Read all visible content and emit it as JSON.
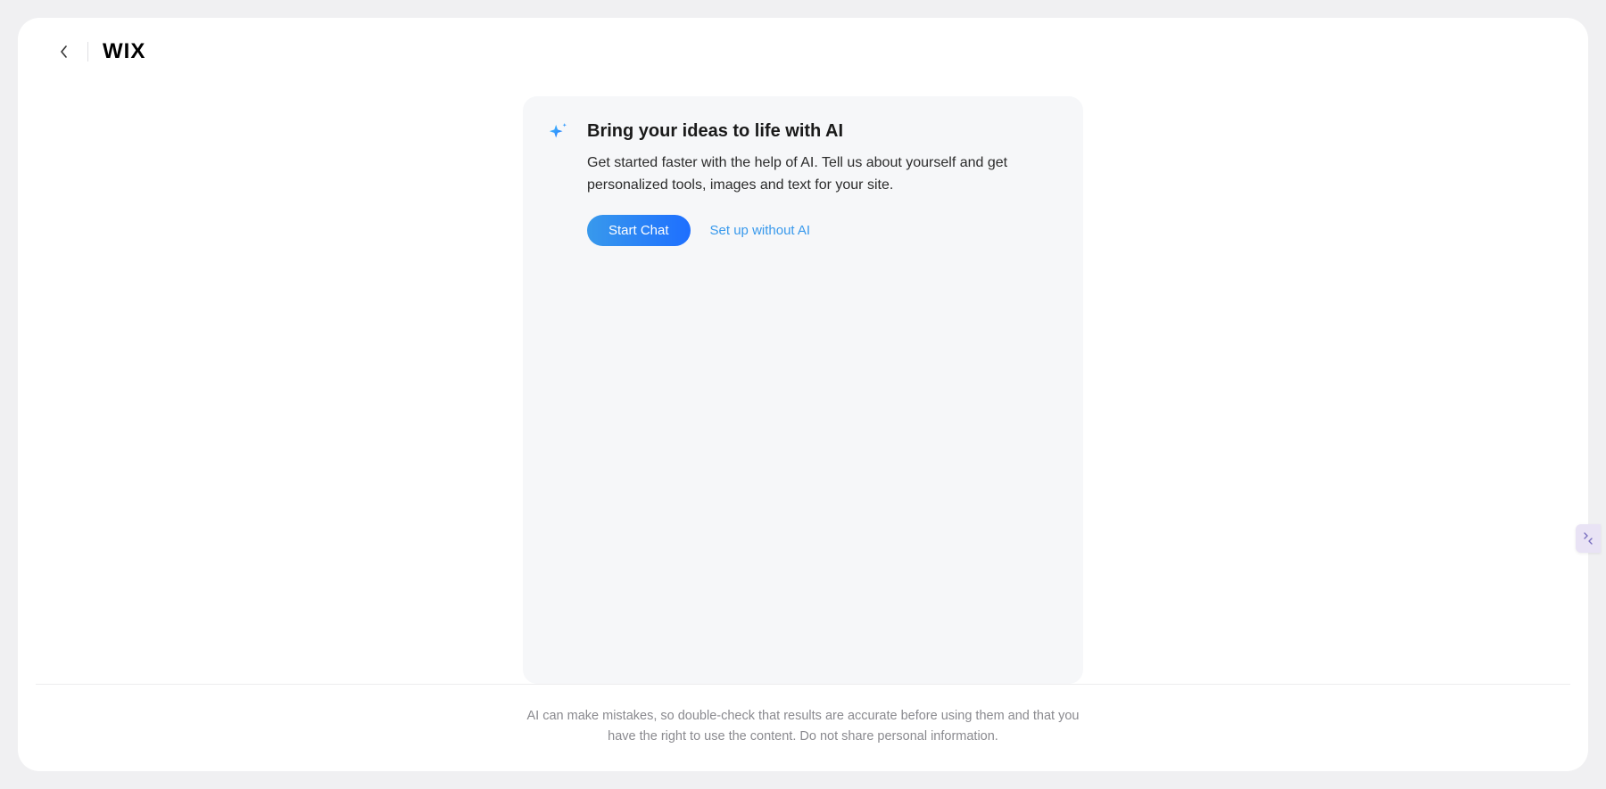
{
  "header": {
    "logo_text": "WIX"
  },
  "card": {
    "title": "Bring your ideas to life with AI",
    "description": "Get started faster with the help of AI. Tell us about yourself and get personalized tools, images and text for your site.",
    "primary_button": "Start Chat",
    "secondary_link": "Set up without AI"
  },
  "footer": {
    "disclaimer": "AI can make mistakes, so double-check that results are accurate before using them and that you have the right to use the content. Do not share personal information."
  }
}
